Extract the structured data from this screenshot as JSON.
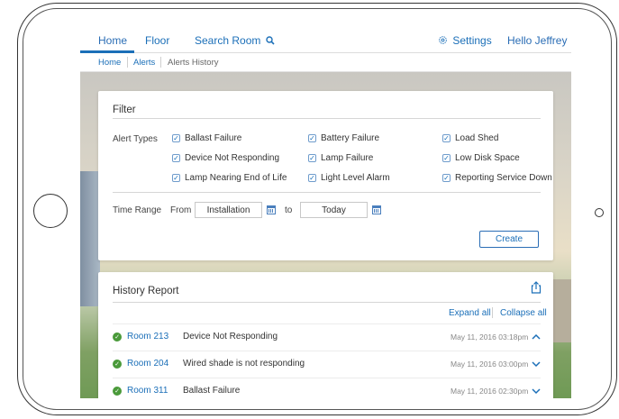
{
  "nav": {
    "home": "Home",
    "floor": "Floor",
    "search": "Search Room",
    "settings": "Settings",
    "user": "Hello Jeffrey"
  },
  "breadcrumb": [
    "Home",
    "Alerts",
    "Alerts History"
  ],
  "filter": {
    "title": "Filter",
    "alert_types_label": "Alert Types",
    "alert_types": [
      {
        "label": "Ballast Failure",
        "checked": true
      },
      {
        "label": "Battery Failure",
        "checked": true
      },
      {
        "label": "Load Shed",
        "checked": true
      },
      {
        "label": "Device Not Responding",
        "checked": true
      },
      {
        "label": "Lamp Failure",
        "checked": true
      },
      {
        "label": "Low Disk Space",
        "checked": true
      },
      {
        "label": "Lamp Nearing End of Life",
        "checked": true
      },
      {
        "label": "Light Level Alarm",
        "checked": true
      },
      {
        "label": "Reporting Service Down",
        "checked": true
      }
    ],
    "time_range_label": "Time Range",
    "from_label": "From",
    "from_value": "Installation",
    "to_label": "to",
    "to_value": "Today",
    "create_label": "Create"
  },
  "history": {
    "title": "History Report",
    "expand_all": "Expand all",
    "collapse_all": "Collapse all",
    "rows": [
      {
        "room": "Room 213",
        "alert": "Device Not Responding",
        "time": "May 11, 2016 03:18pm",
        "expanded": true
      },
      {
        "room": "Room 204",
        "alert": "Wired shade is not responding",
        "time": "May 11, 2016 03:00pm",
        "expanded": false
      },
      {
        "room": "Room 311",
        "alert": "Ballast Failure",
        "time": "May 11, 2016 02:30pm",
        "expanded": false
      }
    ]
  },
  "colors": {
    "accent": "#1b6fb8",
    "success": "#4a9a3a"
  }
}
